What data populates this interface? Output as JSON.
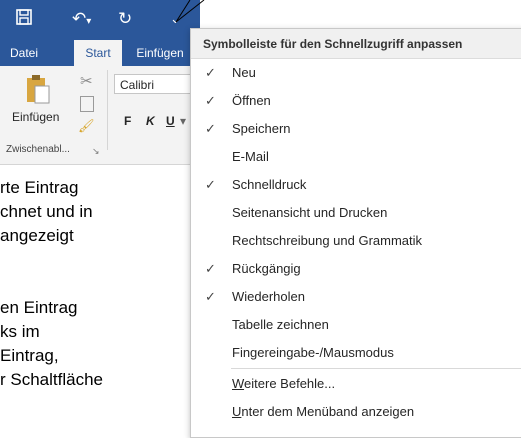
{
  "quick_access_toolbar": {
    "save_icon": "save-icon",
    "undo_icon": "undo-icon",
    "redo_icon": "redo-icon",
    "customize_icon": "customize-dropdown-icon"
  },
  "tabs": [
    {
      "label": "Datei"
    },
    {
      "label": "Start"
    },
    {
      "label": "Einfügen"
    }
  ],
  "ribbon": {
    "paste_label": "Einfügen",
    "font_name": "Calibri",
    "bold": "F",
    "italic": "K",
    "underline": "U",
    "group_label": "Zwischenabl..."
  },
  "document_lines": [
    "rte Eintrag",
    "chnet und in",
    "angezeigt",
    "en Eintrag",
    "ks im",
    "Eintrag,",
    "r Schaltfläche"
  ],
  "menu": {
    "title": "Symbolleiste für den Schnellzugriff anpassen",
    "items": [
      {
        "label": "Neu",
        "checked": true
      },
      {
        "label": "Öffnen",
        "checked": true
      },
      {
        "label": "Speichern",
        "checked": true
      },
      {
        "label": "E-Mail",
        "checked": false
      },
      {
        "label": "Schnelldruck",
        "checked": true
      },
      {
        "label": "Seitenansicht und Drucken",
        "checked": false
      },
      {
        "label": "Rechtschreibung und Grammatik",
        "checked": false
      },
      {
        "label": "Rückgängig",
        "checked": true
      },
      {
        "label": "Wiederholen",
        "checked": true
      },
      {
        "label": "Tabelle zeichnen",
        "checked": false
      },
      {
        "label": "Fingereingabe-/Mausmodus",
        "checked": false
      }
    ],
    "more_commands": {
      "accel": "W",
      "rest": "eitere Befehle..."
    },
    "show_below": {
      "accel": "U",
      "rest": "nter dem Menüband anzeigen"
    }
  },
  "colors": {
    "word_blue": "#2b579a",
    "ribbon_bg": "#f3f3f3"
  }
}
